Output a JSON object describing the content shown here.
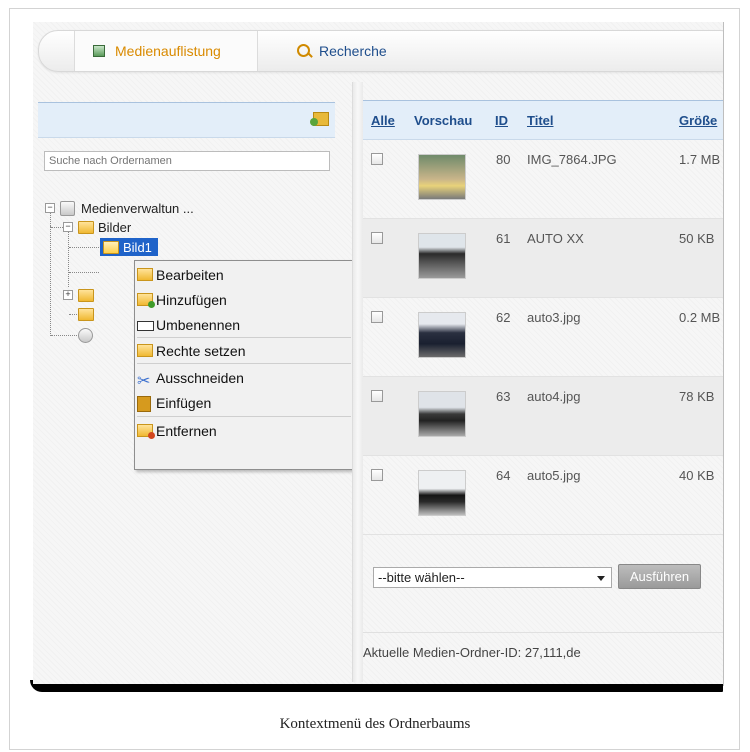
{
  "tabs": {
    "media_label": "Medienauflistung",
    "search_label": "Recherche"
  },
  "tree": {
    "search_placeholder": "Suche nach Ordernamen",
    "root_label": "Medienverwaltun ...",
    "folder_bilder": "Bilder",
    "folder_bild1": "Bild1"
  },
  "context_menu": {
    "items": [
      "Bearbeiten",
      "Hinzufügen",
      "Umbenennen",
      "Rechte setzen",
      "Ausschneiden",
      "Einfügen",
      "Entfernen"
    ]
  },
  "table": {
    "headers": {
      "all": "Alle",
      "preview": "Vorschau",
      "id": "ID",
      "title": "Titel",
      "size": "Größe"
    },
    "rows": [
      {
        "id": "80",
        "title": "IMG_7864.JPG",
        "size": "1.7 MB"
      },
      {
        "id": "61",
        "title": "AUTO XX",
        "size": "50 KB"
      },
      {
        "id": "62",
        "title": "auto3.jpg",
        "size": "0.2 MB"
      },
      {
        "id": "63",
        "title": "auto4.jpg",
        "size": "78 KB"
      },
      {
        "id": "64",
        "title": "auto5.jpg",
        "size": "40 KB"
      }
    ],
    "action_select_value": "--bitte wählen--",
    "run_label": "Ausführen",
    "folder_id_text": "Aktuelle Medien-Ordner-ID: 27,111,de"
  },
  "caption": "Kontextmenü des Ordnerbaums",
  "colors": {
    "accent_orange": "#d98a00",
    "link_blue": "#1f4e8c",
    "selection_blue": "#1f63c9",
    "header_bg": "#e3eef9"
  }
}
